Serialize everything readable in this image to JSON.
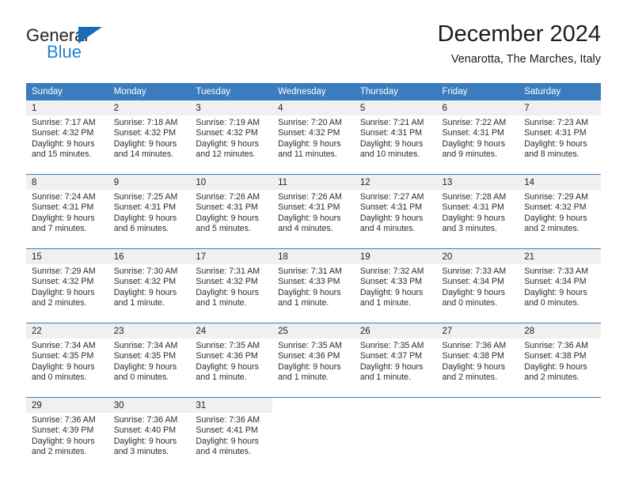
{
  "brand": {
    "name_part1": "General",
    "name_part2": "Blue",
    "triangle_color": "#1a6bb5",
    "blue_text_color": "#1e84d6"
  },
  "header": {
    "title": "December 2024",
    "subtitle": "Venarotta, The Marches, Italy"
  },
  "theme": {
    "header_bg": "#3a7cbe",
    "header_text": "#ffffff",
    "daynum_bg": "#f0f0f0",
    "cell_bg": "#ffffff",
    "text": "#222222"
  },
  "weekday_headers": [
    "Sunday",
    "Monday",
    "Tuesday",
    "Wednesday",
    "Thursday",
    "Friday",
    "Saturday"
  ],
  "weeks": [
    {
      "days": [
        {
          "num": "1",
          "sunrise": "Sunrise: 7:17 AM",
          "sunset": "Sunset: 4:32 PM",
          "daylight1": "Daylight: 9 hours",
          "daylight2": "and 15 minutes."
        },
        {
          "num": "2",
          "sunrise": "Sunrise: 7:18 AM",
          "sunset": "Sunset: 4:32 PM",
          "daylight1": "Daylight: 9 hours",
          "daylight2": "and 14 minutes."
        },
        {
          "num": "3",
          "sunrise": "Sunrise: 7:19 AM",
          "sunset": "Sunset: 4:32 PM",
          "daylight1": "Daylight: 9 hours",
          "daylight2": "and 12 minutes."
        },
        {
          "num": "4",
          "sunrise": "Sunrise: 7:20 AM",
          "sunset": "Sunset: 4:32 PM",
          "daylight1": "Daylight: 9 hours",
          "daylight2": "and 11 minutes."
        },
        {
          "num": "5",
          "sunrise": "Sunrise: 7:21 AM",
          "sunset": "Sunset: 4:31 PM",
          "daylight1": "Daylight: 9 hours",
          "daylight2": "and 10 minutes."
        },
        {
          "num": "6",
          "sunrise": "Sunrise: 7:22 AM",
          "sunset": "Sunset: 4:31 PM",
          "daylight1": "Daylight: 9 hours",
          "daylight2": "and 9 minutes."
        },
        {
          "num": "7",
          "sunrise": "Sunrise: 7:23 AM",
          "sunset": "Sunset: 4:31 PM",
          "daylight1": "Daylight: 9 hours",
          "daylight2": "and 8 minutes."
        }
      ]
    },
    {
      "days": [
        {
          "num": "8",
          "sunrise": "Sunrise: 7:24 AM",
          "sunset": "Sunset: 4:31 PM",
          "daylight1": "Daylight: 9 hours",
          "daylight2": "and 7 minutes."
        },
        {
          "num": "9",
          "sunrise": "Sunrise: 7:25 AM",
          "sunset": "Sunset: 4:31 PM",
          "daylight1": "Daylight: 9 hours",
          "daylight2": "and 6 minutes."
        },
        {
          "num": "10",
          "sunrise": "Sunrise: 7:26 AM",
          "sunset": "Sunset: 4:31 PM",
          "daylight1": "Daylight: 9 hours",
          "daylight2": "and 5 minutes."
        },
        {
          "num": "11",
          "sunrise": "Sunrise: 7:26 AM",
          "sunset": "Sunset: 4:31 PM",
          "daylight1": "Daylight: 9 hours",
          "daylight2": "and 4 minutes."
        },
        {
          "num": "12",
          "sunrise": "Sunrise: 7:27 AM",
          "sunset": "Sunset: 4:31 PM",
          "daylight1": "Daylight: 9 hours",
          "daylight2": "and 4 minutes."
        },
        {
          "num": "13",
          "sunrise": "Sunrise: 7:28 AM",
          "sunset": "Sunset: 4:31 PM",
          "daylight1": "Daylight: 9 hours",
          "daylight2": "and 3 minutes."
        },
        {
          "num": "14",
          "sunrise": "Sunrise: 7:29 AM",
          "sunset": "Sunset: 4:32 PM",
          "daylight1": "Daylight: 9 hours",
          "daylight2": "and 2 minutes."
        }
      ]
    },
    {
      "days": [
        {
          "num": "15",
          "sunrise": "Sunrise: 7:29 AM",
          "sunset": "Sunset: 4:32 PM",
          "daylight1": "Daylight: 9 hours",
          "daylight2": "and 2 minutes."
        },
        {
          "num": "16",
          "sunrise": "Sunrise: 7:30 AM",
          "sunset": "Sunset: 4:32 PM",
          "daylight1": "Daylight: 9 hours",
          "daylight2": "and 1 minute."
        },
        {
          "num": "17",
          "sunrise": "Sunrise: 7:31 AM",
          "sunset": "Sunset: 4:32 PM",
          "daylight1": "Daylight: 9 hours",
          "daylight2": "and 1 minute."
        },
        {
          "num": "18",
          "sunrise": "Sunrise: 7:31 AM",
          "sunset": "Sunset: 4:33 PM",
          "daylight1": "Daylight: 9 hours",
          "daylight2": "and 1 minute."
        },
        {
          "num": "19",
          "sunrise": "Sunrise: 7:32 AM",
          "sunset": "Sunset: 4:33 PM",
          "daylight1": "Daylight: 9 hours",
          "daylight2": "and 1 minute."
        },
        {
          "num": "20",
          "sunrise": "Sunrise: 7:33 AM",
          "sunset": "Sunset: 4:34 PM",
          "daylight1": "Daylight: 9 hours",
          "daylight2": "and 0 minutes."
        },
        {
          "num": "21",
          "sunrise": "Sunrise: 7:33 AM",
          "sunset": "Sunset: 4:34 PM",
          "daylight1": "Daylight: 9 hours",
          "daylight2": "and 0 minutes."
        }
      ]
    },
    {
      "days": [
        {
          "num": "22",
          "sunrise": "Sunrise: 7:34 AM",
          "sunset": "Sunset: 4:35 PM",
          "daylight1": "Daylight: 9 hours",
          "daylight2": "and 0 minutes."
        },
        {
          "num": "23",
          "sunrise": "Sunrise: 7:34 AM",
          "sunset": "Sunset: 4:35 PM",
          "daylight1": "Daylight: 9 hours",
          "daylight2": "and 0 minutes."
        },
        {
          "num": "24",
          "sunrise": "Sunrise: 7:35 AM",
          "sunset": "Sunset: 4:36 PM",
          "daylight1": "Daylight: 9 hours",
          "daylight2": "and 1 minute."
        },
        {
          "num": "25",
          "sunrise": "Sunrise: 7:35 AM",
          "sunset": "Sunset: 4:36 PM",
          "daylight1": "Daylight: 9 hours",
          "daylight2": "and 1 minute."
        },
        {
          "num": "26",
          "sunrise": "Sunrise: 7:35 AM",
          "sunset": "Sunset: 4:37 PM",
          "daylight1": "Daylight: 9 hours",
          "daylight2": "and 1 minute."
        },
        {
          "num": "27",
          "sunrise": "Sunrise: 7:36 AM",
          "sunset": "Sunset: 4:38 PM",
          "daylight1": "Daylight: 9 hours",
          "daylight2": "and 2 minutes."
        },
        {
          "num": "28",
          "sunrise": "Sunrise: 7:36 AM",
          "sunset": "Sunset: 4:38 PM",
          "daylight1": "Daylight: 9 hours",
          "daylight2": "and 2 minutes."
        }
      ]
    },
    {
      "days": [
        {
          "num": "29",
          "sunrise": "Sunrise: 7:36 AM",
          "sunset": "Sunset: 4:39 PM",
          "daylight1": "Daylight: 9 hours",
          "daylight2": "and 2 minutes."
        },
        {
          "num": "30",
          "sunrise": "Sunrise: 7:36 AM",
          "sunset": "Sunset: 4:40 PM",
          "daylight1": "Daylight: 9 hours",
          "daylight2": "and 3 minutes."
        },
        {
          "num": "31",
          "sunrise": "Sunrise: 7:36 AM",
          "sunset": "Sunset: 4:41 PM",
          "daylight1": "Daylight: 9 hours",
          "daylight2": "and 4 minutes."
        },
        {
          "num": "",
          "sunrise": "",
          "sunset": "",
          "daylight1": "",
          "daylight2": ""
        },
        {
          "num": "",
          "sunrise": "",
          "sunset": "",
          "daylight1": "",
          "daylight2": ""
        },
        {
          "num": "",
          "sunrise": "",
          "sunset": "",
          "daylight1": "",
          "daylight2": ""
        },
        {
          "num": "",
          "sunrise": "",
          "sunset": "",
          "daylight1": "",
          "daylight2": ""
        }
      ]
    }
  ]
}
